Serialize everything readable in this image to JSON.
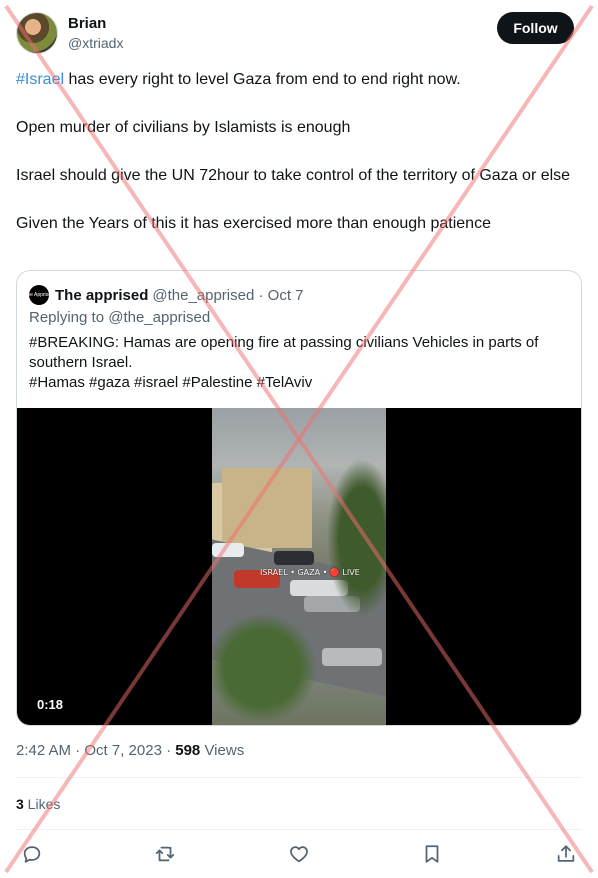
{
  "author": {
    "name": "Brian",
    "handle": "@xtriadx"
  },
  "follow_label": "Follow",
  "tweet": {
    "p1_hashtag": "#Israel",
    "p1_rest": " has every right to level Gaza from end to end right now.",
    "p2": "Open murder of civilians by Islamists is enough",
    "p3": "Israel should give the UN 72hour to take control of the territory of Gaza or else",
    "p4": "Given the Years of this it has exercised more than enough patience"
  },
  "quote": {
    "avatar_text": "The Apprised",
    "name": "The apprised",
    "handle_date": "@the_apprised · Oct 7",
    "replying_to": "Replying to @the_apprised",
    "line1": "#BREAKING: Hamas are opening fire at passing civilians Vehicles in parts of southern Israel.",
    "line2": "#Hamas #gaza #israel #Palestine #TelAviv",
    "video_watermark": "ISRAEL • GAZA • 🔴 LIVE",
    "video_duration": "0:18"
  },
  "meta": {
    "time_date": "2:42 AM · Oct 7, 2023 · ",
    "views_count": "598",
    "views_label": " Views"
  },
  "likes": {
    "count": "3",
    "label": " Likes"
  },
  "actions": [
    "reply-icon",
    "retweet-icon",
    "like-icon",
    "bookmark-icon",
    "share-icon"
  ],
  "colors": {
    "hashtag": "#3a8fd4",
    "cross": "#f26d6d"
  }
}
